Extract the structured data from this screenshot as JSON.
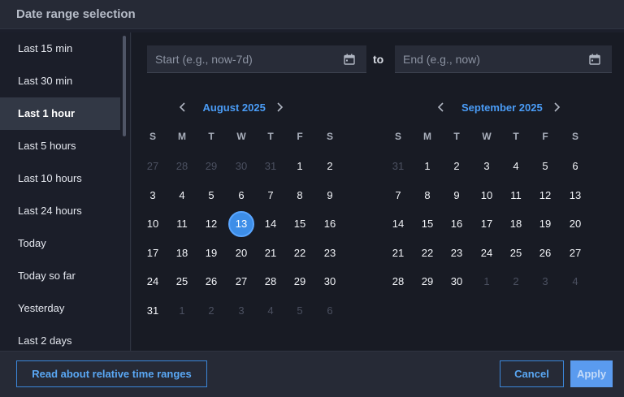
{
  "header": {
    "title": "Date range selection"
  },
  "sidebar": {
    "items": [
      {
        "label": "Last 15 min",
        "active": false
      },
      {
        "label": "Last 30 min",
        "active": false
      },
      {
        "label": "Last 1 hour",
        "active": true
      },
      {
        "label": "Last 5 hours",
        "active": false
      },
      {
        "label": "Last 10 hours",
        "active": false
      },
      {
        "label": "Last 24 hours",
        "active": false
      },
      {
        "label": "Today",
        "active": false
      },
      {
        "label": "Today so far",
        "active": false
      },
      {
        "label": "Yesterday",
        "active": false
      },
      {
        "label": "Last 2 days",
        "active": false
      }
    ]
  },
  "range": {
    "start": {
      "placeholder": "Start (e.g., now-7d)",
      "value": ""
    },
    "separator": "to",
    "end": {
      "placeholder": "End (e.g., now)",
      "value": ""
    }
  },
  "calendars": [
    {
      "title": "August 2025",
      "weekdays": [
        "S",
        "M",
        "T",
        "W",
        "T",
        "F",
        "S"
      ],
      "weeks": [
        [
          "27",
          "28",
          "29",
          "30",
          "31",
          "1",
          "2"
        ],
        [
          "3",
          "4",
          "5",
          "6",
          "7",
          "8",
          "9"
        ],
        [
          "10",
          "11",
          "12",
          "13",
          "14",
          "15",
          "16"
        ],
        [
          "17",
          "18",
          "19",
          "20",
          "21",
          "22",
          "23"
        ],
        [
          "24",
          "25",
          "26",
          "27",
          "28",
          "29",
          "30"
        ],
        [
          "31",
          "1",
          "2",
          "3",
          "4",
          "5",
          "6"
        ]
      ],
      "outside_month": [
        [
          0,
          0
        ],
        [
          0,
          1
        ],
        [
          0,
          2
        ],
        [
          0,
          3
        ],
        [
          0,
          4
        ],
        [
          5,
          1
        ],
        [
          5,
          2
        ],
        [
          5,
          3
        ],
        [
          5,
          4
        ],
        [
          5,
          5
        ],
        [
          5,
          6
        ]
      ],
      "selected": [
        2,
        3
      ]
    },
    {
      "title": "September 2025",
      "weekdays": [
        "S",
        "M",
        "T",
        "W",
        "T",
        "F",
        "S"
      ],
      "weeks": [
        [
          "31",
          "1",
          "2",
          "3",
          "4",
          "5",
          "6"
        ],
        [
          "7",
          "8",
          "9",
          "10",
          "11",
          "12",
          "13"
        ],
        [
          "14",
          "15",
          "16",
          "17",
          "18",
          "19",
          "20"
        ],
        [
          "21",
          "22",
          "23",
          "24",
          "25",
          "26",
          "27"
        ],
        [
          "28",
          "29",
          "30",
          "1",
          "2",
          "3",
          "4"
        ]
      ],
      "outside_month": [
        [
          0,
          0
        ],
        [
          4,
          3
        ],
        [
          4,
          4
        ],
        [
          4,
          5
        ],
        [
          4,
          6
        ]
      ],
      "selected": null
    }
  ],
  "footer": {
    "help_label": "Read about relative time ranges",
    "cancel_label": "Cancel",
    "apply_label": "Apply"
  },
  "colors": {
    "accent": "#4a9cf6",
    "selected_day": "#3d8ee8",
    "apply_button": "#5a9bef"
  },
  "icons": {
    "date_input": "calendar-icon",
    "prev": "chevron-left-icon",
    "next": "chevron-right-icon"
  }
}
